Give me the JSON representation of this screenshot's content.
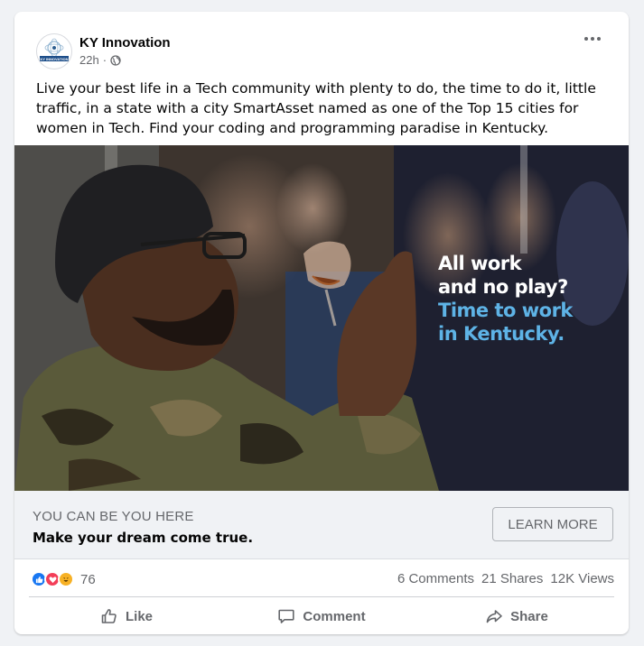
{
  "post": {
    "page_name": "KY Innovation",
    "time": "22h",
    "separator": "·",
    "avatar_label": "KY INNOVATION",
    "text": "Live your best life in a Tech community with plenty to do, the time to do it, little traffic, in a state with a city SmartAsset named as one of the Top 15 cities for women in Tech. Find your coding and programming paradise in Kentucky."
  },
  "image": {
    "line1": "All work",
    "line2": "and no play?",
    "line3": "Time to work",
    "line4": "in Kentucky."
  },
  "link": {
    "domain": "YOU CAN BE YOU HERE",
    "title": "Make your dream come true.",
    "cta": "LEARN MORE"
  },
  "stats": {
    "reaction_count": "76",
    "comments": "6 Comments",
    "shares": "21 Shares",
    "views": "12K Views"
  },
  "actions": {
    "like": "Like",
    "comment": "Comment",
    "share": "Share"
  },
  "colors": {
    "facebook_blue": "#1877f2",
    "love_red": "#f33e58",
    "haha_yellow": "#f7b125",
    "overlay_blue": "#5eb3e6"
  },
  "icons": [
    "kebab-menu-icon",
    "globe-icon",
    "like-reaction-icon",
    "love-reaction-icon",
    "haha-reaction-icon",
    "thumbs-up-icon",
    "comment-icon",
    "share-arrow-icon"
  ]
}
